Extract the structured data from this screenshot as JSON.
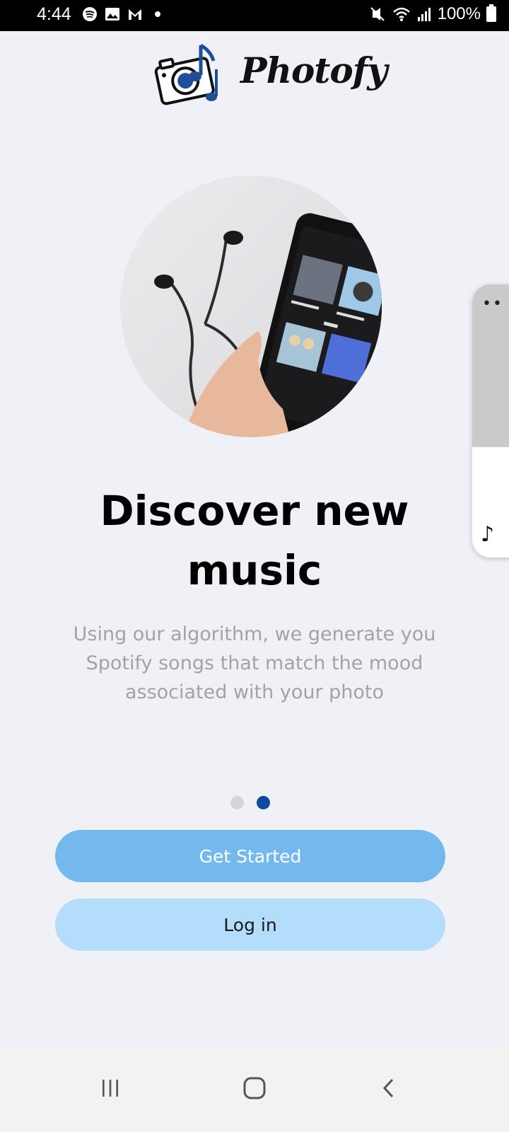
{
  "status_bar": {
    "time": "4:44",
    "battery": "100%",
    "icons_left": [
      "spotify-icon",
      "image-icon",
      "gmail-icon",
      "dot-icon"
    ],
    "icons_right": [
      "mute-icon",
      "wifi-icon",
      "signal-icon",
      "battery-icon"
    ]
  },
  "app": {
    "logo_text": "Photofy"
  },
  "onboarding": {
    "title": "Discover new music",
    "description": "Using our algorithm, we generate you Spotify songs that match the mood associated with your photo",
    "page_indicator": {
      "total": 2,
      "active": 2
    }
  },
  "buttons": {
    "get_started": "Get Started",
    "log_in": "Log in"
  },
  "colors": {
    "background": "#f0f1f6",
    "primary_button": "#74b9ee",
    "secondary_button": "#b4dcfb",
    "active_dot": "#0f4aa0",
    "inactive_dot": "#d5d5d8",
    "description_text": "#a2a2a8"
  },
  "nav_bar": {
    "items": [
      "recent-apps-icon",
      "home-icon",
      "back-icon"
    ]
  }
}
